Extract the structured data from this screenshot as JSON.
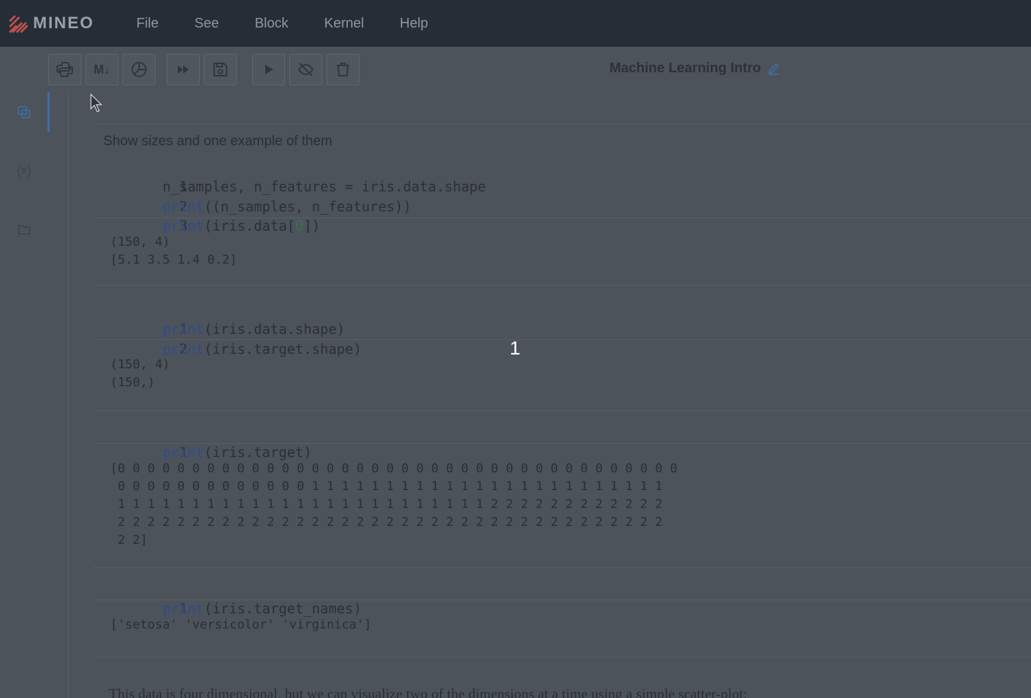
{
  "app": {
    "logo_text": "MINEO",
    "menu": [
      "File",
      "See",
      "Block",
      "Kernel",
      "Help"
    ]
  },
  "toolbar": {
    "buttons": [
      {
        "name": "python-cell-button",
        "icon": "python-icon"
      },
      {
        "name": "markdown-cell-button",
        "icon": "markdown-icon",
        "label": "M↓"
      },
      {
        "name": "chart-cell-button",
        "icon": "pie-chart-icon"
      },
      {
        "name": "run-all-button",
        "icon": "fast-forward-icon"
      },
      {
        "name": "save-button",
        "icon": "save-icon"
      },
      {
        "name": "run-button",
        "icon": "play-icon"
      },
      {
        "name": "hide-code-button",
        "icon": "eye-off-icon"
      },
      {
        "name": "delete-button",
        "icon": "trash-icon"
      }
    ],
    "notebook_title": "Machine Learning Intro"
  },
  "sidebar": {
    "items": [
      {
        "name": "cells-icon"
      },
      {
        "name": "variables-icon",
        "label": "{x}"
      },
      {
        "name": "folder-icon"
      }
    ]
  },
  "cells": {
    "md1": "Show sizes and one example of them",
    "cell1": {
      "lines": [
        {
          "n": "1",
          "pre": "",
          "kw": "",
          "text": "n_samples, n_features = iris.data.shape"
        },
        {
          "n": "2",
          "kw": "print",
          "text": "((n_samples, n_features))"
        },
        {
          "n": "3",
          "kw": "print",
          "text_a": "(iris.data[",
          "num": "0",
          "text_b": "])"
        }
      ],
      "output": "(150, 4)\n[5.1 3.5 1.4 0.2]"
    },
    "cell2": {
      "lines": [
        {
          "n": "1",
          "kw": "print",
          "text": "(iris.data.shape)"
        },
        {
          "n": "2",
          "kw": "print",
          "text": "(iris.target.shape)"
        }
      ],
      "output": "(150, 4)\n(150,)"
    },
    "cell3": {
      "lines": [
        {
          "n": "1",
          "kw": "print",
          "text": "(iris.target)"
        }
      ],
      "output": "[0 0 0 0 0 0 0 0 0 0 0 0 0 0 0 0 0 0 0 0 0 0 0 0 0 0 0 0 0 0 0 0 0 0 0 0 0 0\n 0 0 0 0 0 0 0 0 0 0 0 0 0 1 1 1 1 1 1 1 1 1 1 1 1 1 1 1 1 1 1 1 1 1 1 1 1\n 1 1 1 1 1 1 1 1 1 1 1 1 1 1 1 1 1 1 1 1 1 1 1 1 1 2 2 2 2 2 2 2 2 2 2 2 2\n 2 2 2 2 2 2 2 2 2 2 2 2 2 2 2 2 2 2 2 2 2 2 2 2 2 2 2 2 2 2 2 2 2 2 2 2 2\n 2 2]"
    },
    "cell4": {
      "lines": [
        {
          "n": "1",
          "kw": "print",
          "text": "(iris.target_names)"
        }
      ],
      "output": "['setosa' 'versicolor' 'virginica']"
    },
    "md2": "This data is four dimensional, but we can visualize two of the dimensions at a time using a simple scatter-plot:"
  },
  "overlay": {
    "number": "1"
  }
}
